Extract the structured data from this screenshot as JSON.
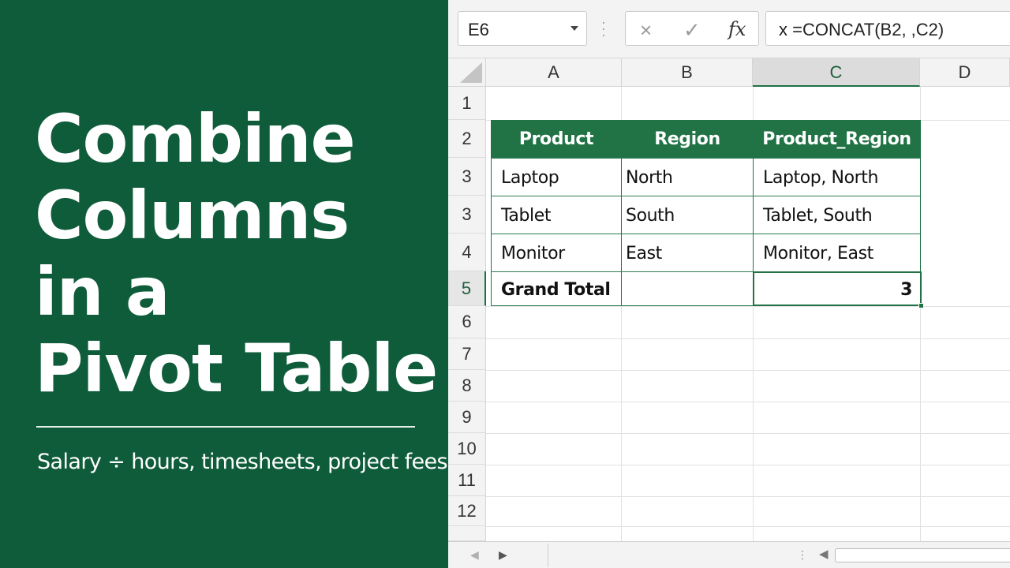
{
  "banner": {
    "headline_lines": [
      "Combine",
      "Columns",
      "in a",
      "Pivot Table"
    ],
    "subtitle": "Salary ÷ hours, timesheets, project fees",
    "background_color": "#0f5c3b"
  },
  "formula_bar": {
    "name_box": "E6",
    "cancel_icon": "×",
    "enter_icon": "✓",
    "fx_label": "fx",
    "formula": "x =CONCAT(B2, ,C2)"
  },
  "columns": [
    "A",
    "B",
    "C",
    "D"
  ],
  "active_column": "C",
  "rows": [
    "1",
    "2",
    "3",
    "3",
    "4",
    "5",
    "6",
    "7",
    "8",
    "9",
    "10",
    "11",
    "12"
  ],
  "active_row": "5",
  "table": {
    "headers": [
      "Product",
      "Region",
      "Product_Region"
    ],
    "rows": [
      [
        "Laptop",
        "North",
        "Laptop, North"
      ],
      [
        "Tablet",
        "South",
        "Tablet, South"
      ],
      [
        "Monitor",
        "East",
        "Monitor, East"
      ]
    ],
    "total": {
      "label": "Grand Total",
      "value": "3"
    },
    "header_color": "#217346"
  },
  "bottom_bar": {
    "prev_icon": "◀",
    "next_icon": "▶",
    "dots": "⋮",
    "scroll_left_icon": "◀"
  }
}
